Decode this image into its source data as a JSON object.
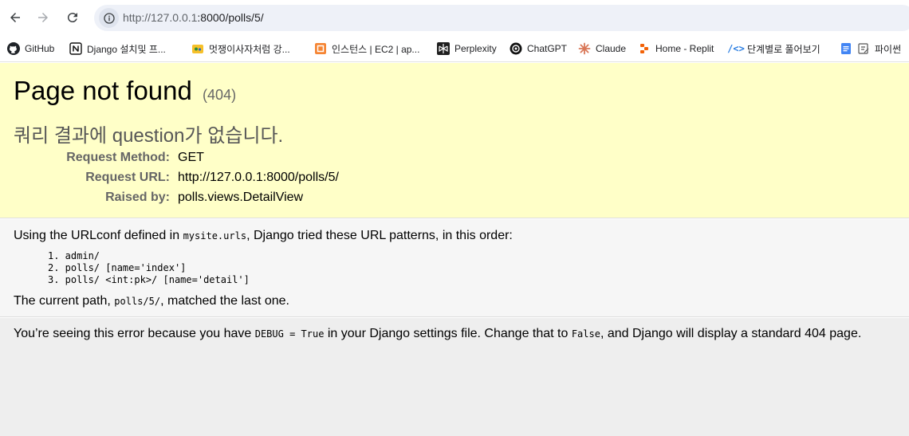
{
  "browser": {
    "url_host": "http://127.0.0.1",
    "url_rest": ":8000/polls/5/",
    "bookmarks": [
      {
        "label": "GitHub",
        "icon": "github-icon"
      },
      {
        "label": "Django 설치및 프...",
        "icon": "notion-icon"
      },
      {
        "label": "멋쟁이사자처럼 강...",
        "icon": "folder-icon"
      },
      {
        "label": "인스턴스 | EC2 | ap...",
        "icon": "aws-icon"
      },
      {
        "label": "Perplexity",
        "icon": "perplexity-icon"
      },
      {
        "label": "ChatGPT",
        "icon": "chatgpt-icon"
      },
      {
        "label": "Claude",
        "icon": "claude-icon"
      },
      {
        "label": "Home - Replit",
        "icon": "replit-icon"
      },
      {
        "label": "단계별로 풀어보기",
        "icon": "code-icon"
      },
      {
        "label": "파이썬 ",
        "icon": "docs-icon"
      }
    ]
  },
  "summary": {
    "title": "Page not found",
    "status_code": "(404)",
    "exception": "쿼리 결과에 question가 없습니다.",
    "request_method_label": "Request Method:",
    "request_method": "GET",
    "request_url_label": "Request URL:",
    "request_url": "http://127.0.0.1:8000/polls/5/",
    "raised_by_label": "Raised by:",
    "raised_by": "polls.views.DetailView"
  },
  "info": {
    "intro_before": "Using the URLconf defined in ",
    "urlconf": "mysite.urls",
    "intro_after": ", Django tried these URL patterns, in this order:",
    "patterns": [
      "1. admin/",
      "2. polls/ [name='index']",
      "3. polls/ <int:pk>/ [name='detail']"
    ],
    "current_before": "The current path, ",
    "current_path": "polls/5/",
    "current_after": ", matched the last one."
  },
  "explanation": {
    "part1": "You’re seeing this error because you have ",
    "debug_code": "DEBUG = True",
    "part2": " in your Django settings file. Change that to ",
    "false_code": "False",
    "part3": ", and Django will display a standard 404 page."
  }
}
